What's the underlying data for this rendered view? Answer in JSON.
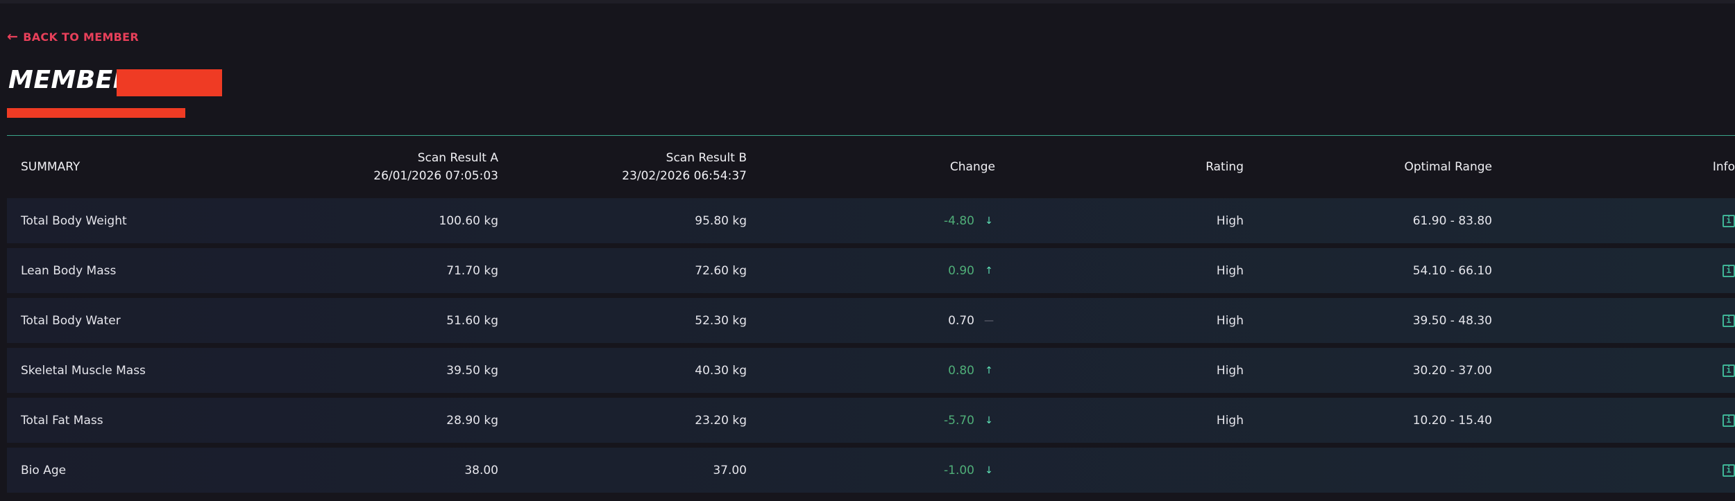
{
  "nav": {
    "back_label": "BACK TO MEMBER",
    "back_icon": "arrow-left-icon"
  },
  "page": {
    "title": "MEMBER"
  },
  "colors": {
    "accent": "#e8405a",
    "divider": "#3aa58b",
    "redaction": "#ef3b24",
    "positive": "#4fae78",
    "icon": "#3fb596"
  },
  "table": {
    "headers": {
      "summary": "SUMMARY",
      "scan_a_label": "Scan Result A",
      "scan_a_date": "26/01/2026 07:05:03",
      "scan_b_label": "Scan Result B",
      "scan_b_date": "23/02/2026 06:54:37",
      "change": "Change",
      "rating": "Rating",
      "optimal_range": "Optimal Range",
      "info": "Info"
    },
    "rows": [
      {
        "name": "Total Body Weight",
        "a": "100.60 kg",
        "b": "95.80 kg",
        "change": "-4.80",
        "trend": "↓",
        "trend_icon": "arrow-down-icon",
        "rating": "High",
        "range": "61.90 - 83.80",
        "info": "i"
      },
      {
        "name": "Lean Body Mass",
        "a": "71.70 kg",
        "b": "72.60 kg",
        "change": "0.90",
        "trend": "↑",
        "trend_icon": "arrow-up-icon",
        "rating": "High",
        "range": "54.10 - 66.10",
        "info": "i"
      },
      {
        "name": "Total Body Water",
        "a": "51.60 kg",
        "b": "52.30 kg",
        "change": "0.70",
        "trend": "—",
        "trend_icon": "dash-icon",
        "rating": "High",
        "range": "39.50 - 48.30",
        "info": "i"
      },
      {
        "name": "Skeletal Muscle Mass",
        "a": "39.50 kg",
        "b": "40.30 kg",
        "change": "0.80",
        "trend": "↑",
        "trend_icon": "arrow-up-icon",
        "rating": "High",
        "range": "30.20 - 37.00",
        "info": "i"
      },
      {
        "name": "Total Fat Mass",
        "a": "28.90 kg",
        "b": "23.20 kg",
        "change": "-5.70",
        "trend": "↓",
        "trend_icon": "arrow-down-icon",
        "rating": "High",
        "range": "10.20 - 15.40",
        "info": "i"
      },
      {
        "name": "Bio Age",
        "a": "38.00",
        "b": "37.00",
        "change": "-1.00",
        "trend": "↓",
        "trend_icon": "arrow-down-icon",
        "rating": "",
        "range": "",
        "info": "i"
      }
    ]
  }
}
